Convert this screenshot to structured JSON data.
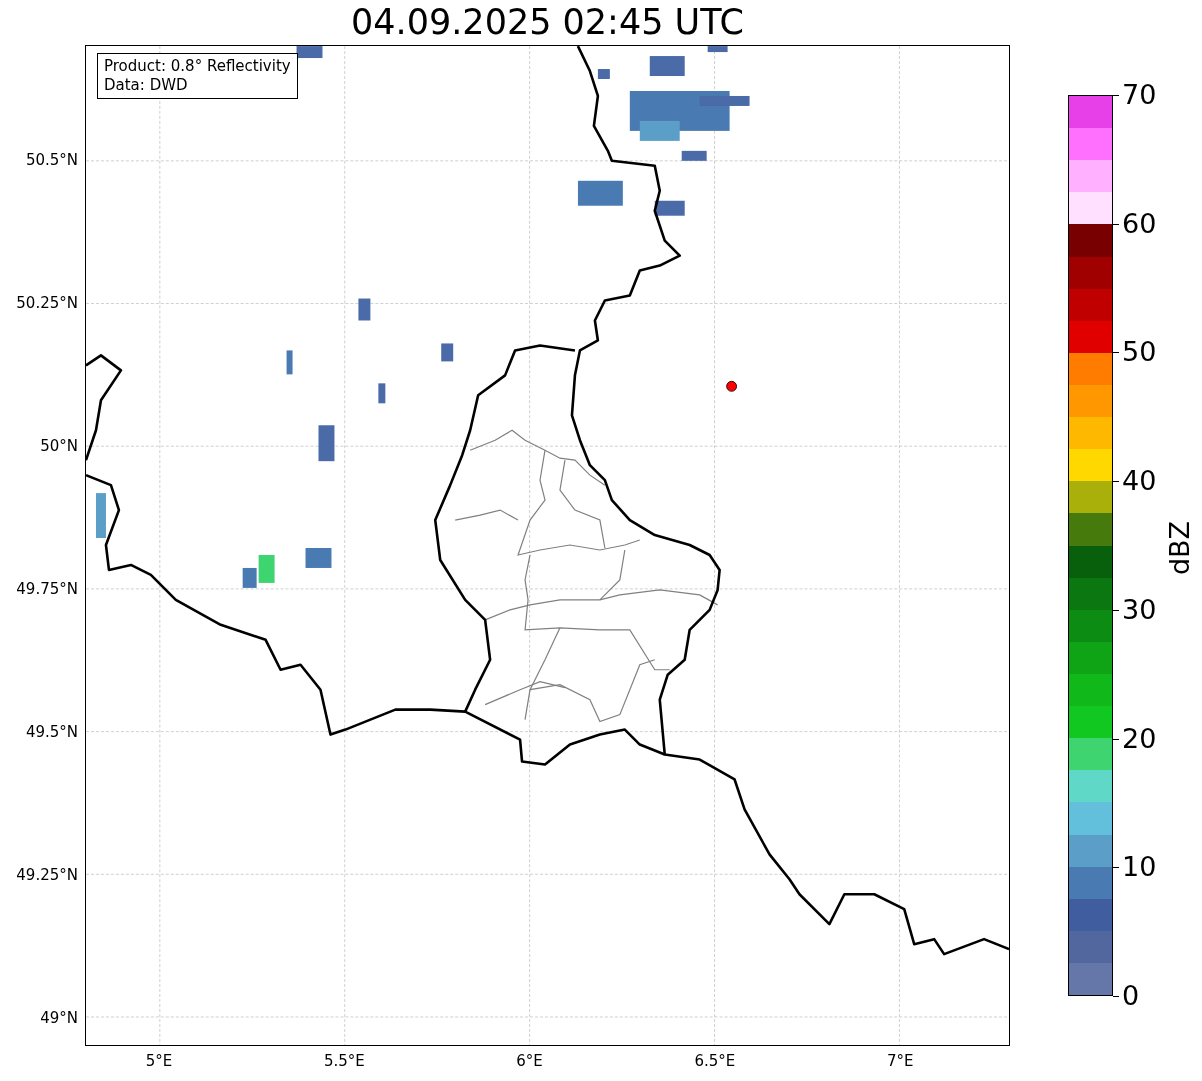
{
  "title": "04.09.2025 02:45 UTC",
  "info_box": {
    "lines": [
      "Product: 0.8° Reflectivity",
      "Data: DWD"
    ]
  },
  "map": {
    "y_tick_labels": [
      "50.5°N",
      "50.25°N",
      "50°N",
      "49.75°N",
      "49.5°N",
      "49.25°N",
      "49°N"
    ],
    "x_tick_labels": [
      "5°E",
      "5.5°E",
      "6°E",
      "6.5°E",
      "7°E"
    ]
  },
  "colorbar": {
    "label": "dBZ",
    "ticks": [
      "70",
      "60",
      "50",
      "40",
      "30",
      "20",
      "10",
      "0"
    ],
    "bands": [
      {
        "color": "#6577a8"
      },
      {
        "color": "#52679e"
      },
      {
        "color": "#405da0"
      },
      {
        "color": "#4a7ab2"
      },
      {
        "color": "#5b9ec7"
      },
      {
        "color": "#63c0dc"
      },
      {
        "color": "#60d8c8"
      },
      {
        "color": "#3ed470"
      },
      {
        "color": "#10c820"
      },
      {
        "color": "#10b81a"
      },
      {
        "color": "#0ea416"
      },
      {
        "color": "#0c8c12"
      },
      {
        "color": "#0a7710"
      },
      {
        "color": "#08600c"
      },
      {
        "color": "#467a0c"
      },
      {
        "color": "#aab00a"
      },
      {
        "color": "#ffd800"
      },
      {
        "color": "#ffb800"
      },
      {
        "color": "#ff9800"
      },
      {
        "color": "#ff7c00"
      },
      {
        "color": "#e00000"
      },
      {
        "color": "#c00000"
      },
      {
        "color": "#a00000"
      },
      {
        "color": "#780000"
      },
      {
        "color": "#ffe0ff"
      },
      {
        "color": "#ffb0ff"
      },
      {
        "color": "#ff70ff"
      },
      {
        "color": "#e840e8"
      }
    ]
  }
}
